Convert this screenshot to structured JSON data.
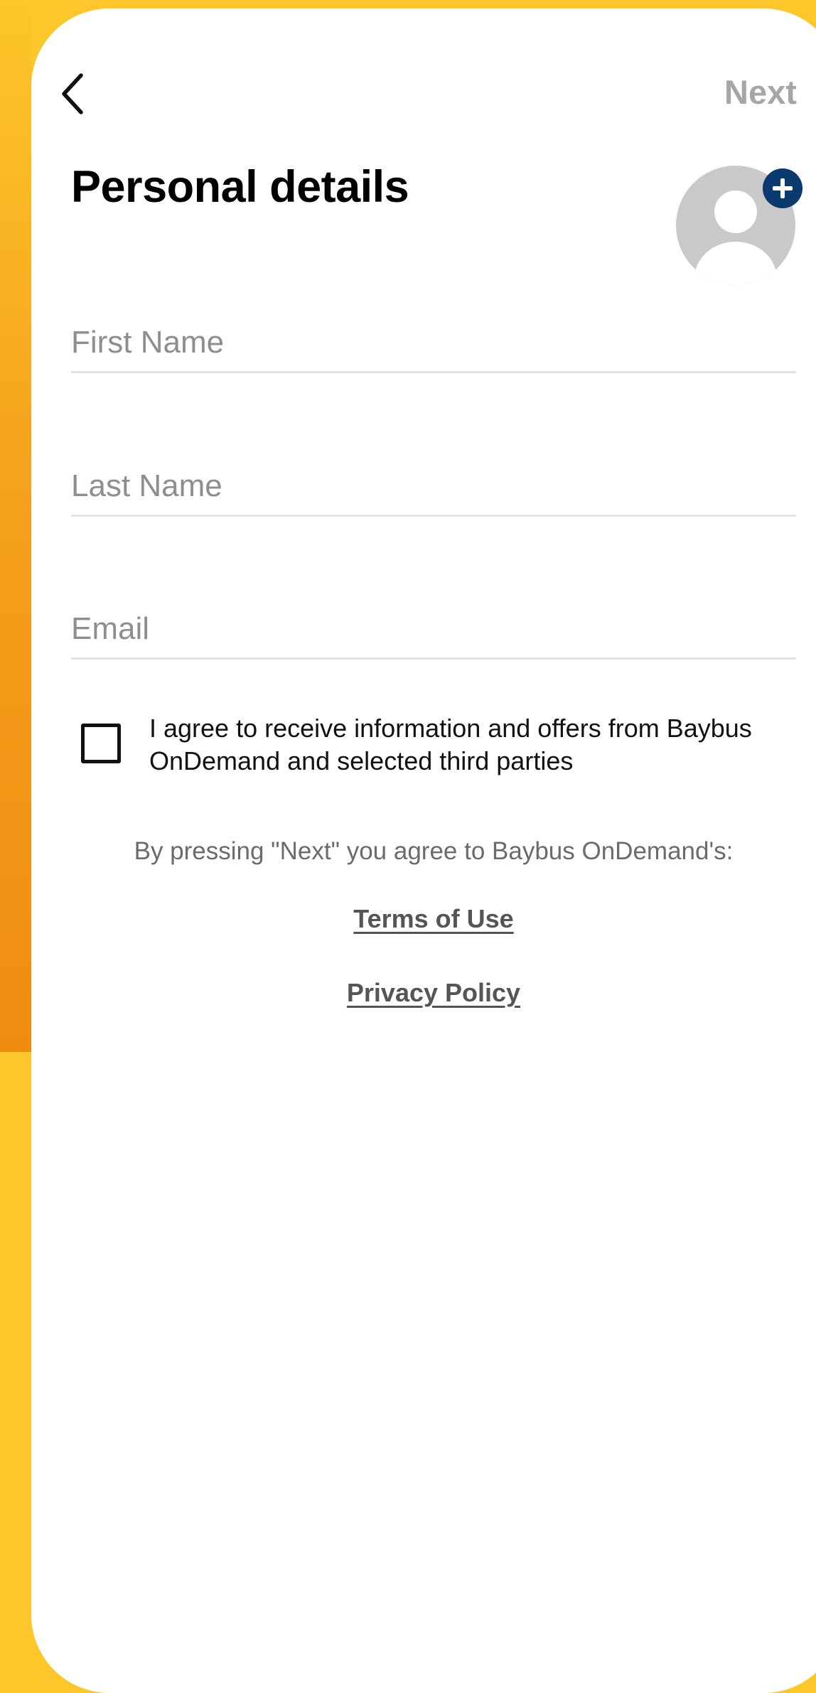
{
  "header": {
    "back_icon": "chevron-left-icon",
    "next_label": "Next"
  },
  "title": "Personal details",
  "avatar": {
    "icon": "user-placeholder-icon",
    "badge_icon": "plus-circle-icon",
    "badge_color": "#0B3A6E"
  },
  "form": {
    "first_name": {
      "value": "",
      "placeholder": "First Name"
    },
    "last_name": {
      "value": "",
      "placeholder": "Last Name"
    },
    "email": {
      "value": "",
      "placeholder": "Email"
    }
  },
  "consent": {
    "checked": false,
    "text": "I agree to receive information and offers from Baybus OnDemand and selected third parties"
  },
  "legal": {
    "agree_text": "By pressing \"Next\" you agree to Baybus OnDemand's:",
    "terms_label": "Terms of Use",
    "privacy_label": "Privacy Policy"
  },
  "colors": {
    "background": "#FDC62A",
    "accent_gradient_end": "#F08C12",
    "card": "#FFFFFF",
    "next_disabled": "#A6A6A6"
  }
}
